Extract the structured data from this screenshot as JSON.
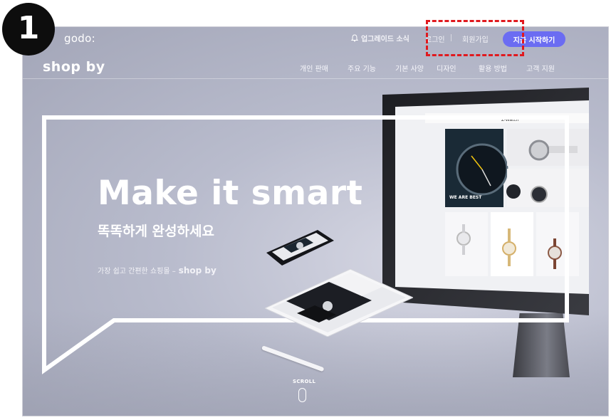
{
  "step_badge": {
    "number": "1"
  },
  "brand": {
    "godo": "godo:",
    "shopby": "shop by"
  },
  "topbar": {
    "notice_label": "업그레이드 소식",
    "login_label": "로그인",
    "signup_label": "회원가입",
    "start_label": "지금 시작하기"
  },
  "nav": {
    "items": [
      {
        "label": "개인 판매"
      },
      {
        "label": "주요 기능"
      },
      {
        "label": "기본 사양"
      },
      {
        "label": "디자인"
      },
      {
        "label": "활용 방법"
      },
      {
        "label": "고객 지원"
      }
    ]
  },
  "hero": {
    "headline": "Make it smart",
    "subhead": "똑똑하게 완성하세요",
    "tagline": "가장 쉽고 간편한 쇼핑몰 –",
    "tagline_brand": "shop by",
    "monitor_banner": "WE ARE BEST",
    "scroll_label": "SCROLL"
  },
  "colors": {
    "accent": "#6b6cf2",
    "highlight": "#e0191e",
    "badge": "#0d0d0d"
  },
  "icons": [
    "bell-icon",
    "scroll-mouse-icon"
  ]
}
